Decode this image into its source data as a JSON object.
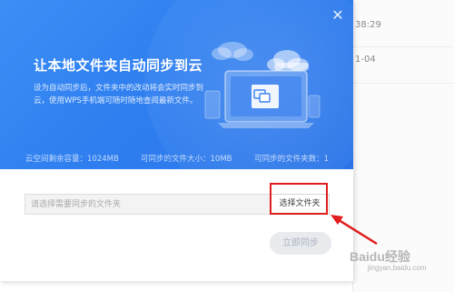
{
  "background_app": {
    "row1_text": "38:29",
    "row2_text": "1-04"
  },
  "dialog": {
    "close_icon": "close-icon",
    "title": "让本地文件夹自动同步到云",
    "description": "设为自动同步后，文件夹中的改动将会实时同步到云，使用WPS手机端可随时随地查阅最新文件。",
    "stats": {
      "cloud_space": "云空间剩余容量：1024MB",
      "file_size": "可同步的文件大小：10MB",
      "folder_count": "可同步的文件夹数：1"
    },
    "folder_input_placeholder": "请选择需要同步的文件夹",
    "choose_folder_label": "选择文件夹",
    "sync_now_label": "立即同步"
  },
  "watermark": {
    "text": "Baidu经验",
    "sub": "jingyan.baidu.com"
  },
  "colors": {
    "banner": "#2f7ff0",
    "annotation": "#e11d1d"
  }
}
